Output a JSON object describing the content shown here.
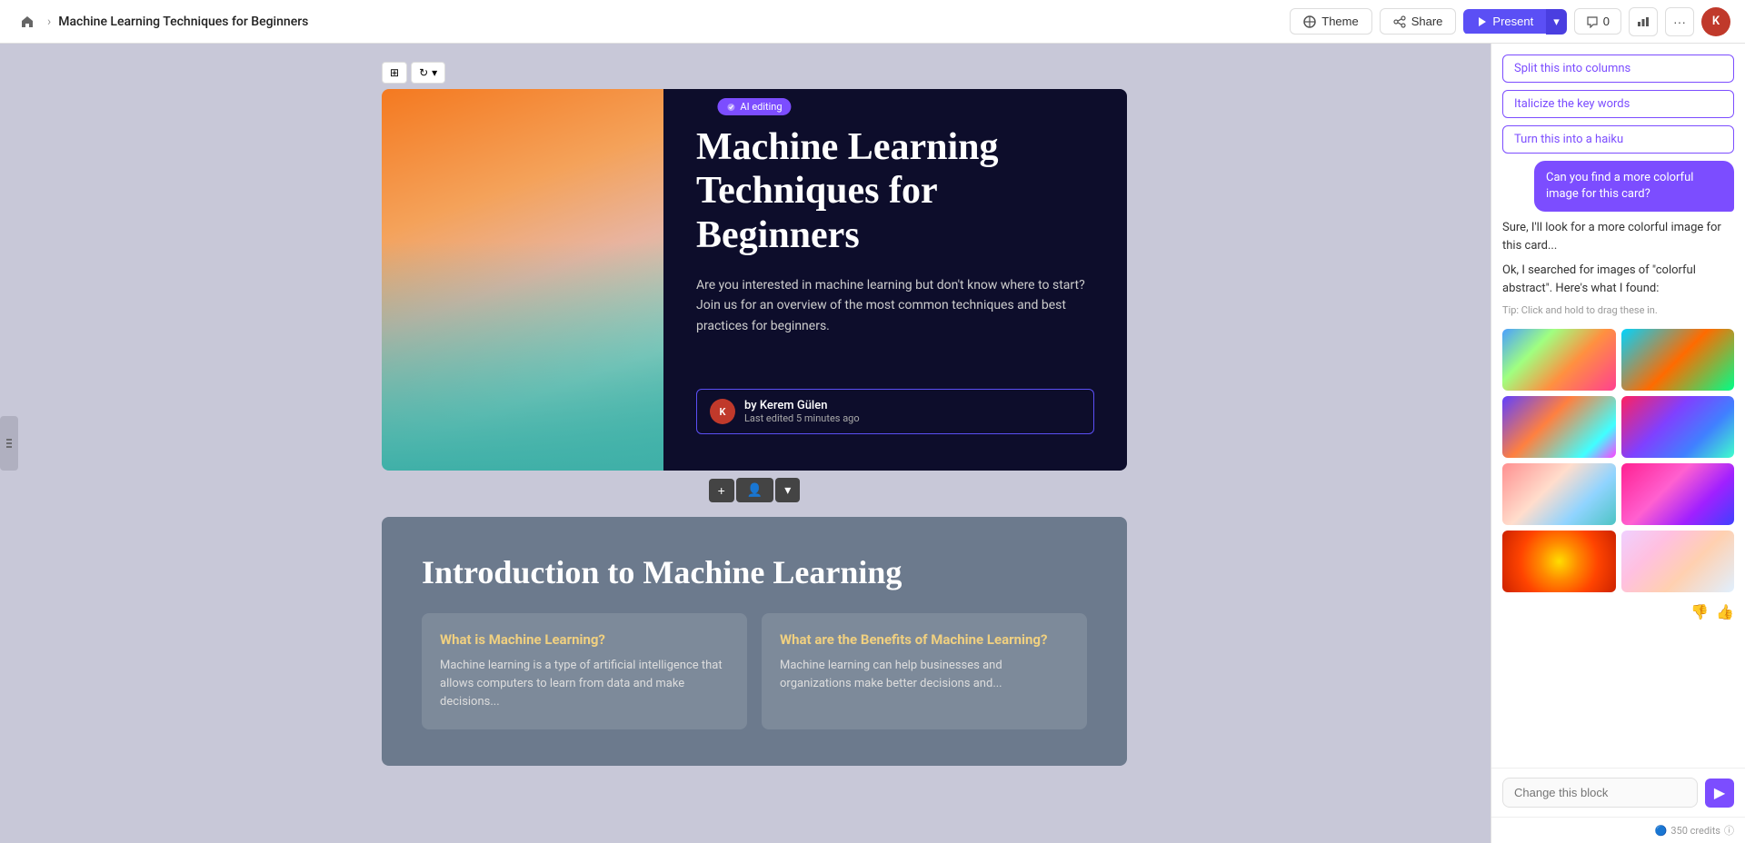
{
  "topbar": {
    "home_icon": "⌂",
    "chevron": "›",
    "title": "Machine Learning Techniques for Beginners",
    "theme_label": "Theme",
    "share_label": "Share",
    "present_label": "Present",
    "comment_count": "0",
    "more_icon": "···",
    "avatar_initials": "K"
  },
  "sidebar": {
    "toggle_icon": "≡"
  },
  "hero_slide": {
    "ai_badge": "AI editing",
    "title": "Machine Learning Techniques for Beginners",
    "description": "Are you interested in machine learning but don't know where to start? Join us for an overview of the most common techniques and best practices for beginners.",
    "author_name": "by Kerem Gülen",
    "author_edited": "Last edited 5 minutes ago",
    "avatar_initials": "K"
  },
  "slide_toolbar": {
    "grid_icon": "⊞",
    "rotate_icon": "↻",
    "caret": "▾"
  },
  "action_bar": {
    "add_icon": "+",
    "person_icon": "👤",
    "caret": "▾"
  },
  "intro_slide": {
    "title": "Introduction to Machine Learning",
    "card1_title": "What is Machine Learning?",
    "card1_text": "Machine learning is a type of artificial intelligence that allows computers to learn from data and make decisions...",
    "card2_title": "What are the Benefits of Machine Learning?",
    "card2_text": "Machine learning can help businesses and organizations make better decisions and..."
  },
  "right_panel": {
    "suggestions": [
      "Split this into columns",
      "Italicize the key words",
      "Turn this into a haiku"
    ],
    "user_message": "Can you find a more colorful image for this card?",
    "ai_response1": "Sure, I'll look for a more colorful image for this card...",
    "ai_response2": "Ok, I searched for images of \"colorful abstract\". Here's what I found:",
    "tip": "Tip: Click and hold to drag these in.",
    "input_placeholder": "Change this block",
    "send_icon": "▶",
    "credits": "350 credits",
    "credits_icon": "🔵"
  }
}
